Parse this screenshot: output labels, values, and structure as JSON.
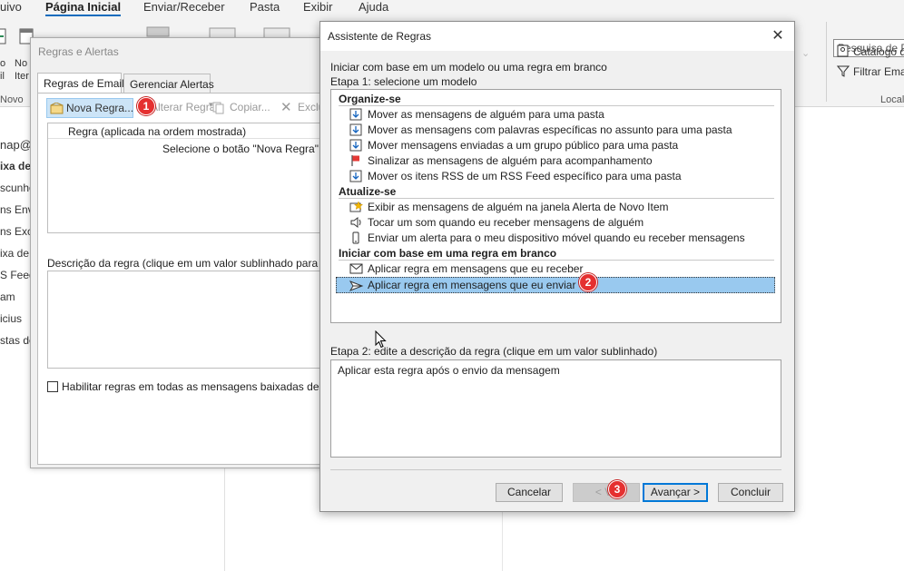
{
  "ribbon": {
    "tabs": [
      {
        "label": "uivo"
      },
      {
        "label": "Página Inicial",
        "active": true
      },
      {
        "label": "Enviar/Receber"
      },
      {
        "label": "Pasta"
      },
      {
        "label": "Exibir"
      },
      {
        "label": "Ajuda"
      }
    ],
    "new_label_1": "o",
    "new_label_2": "il",
    "new_label_3": "No",
    "new_label_4": "Iter",
    "group_novo": "Novo",
    "search_placeholder": "Pesquisa de Pe",
    "catalog": "Catálogo d",
    "filter_email": "Filtrar Ema",
    "group_local": "Local",
    "chevron": "⌄"
  },
  "folders": [
    "nap@",
    "ixa de",
    "scunho",
    "ns Envi",
    "ns Excl",
    "ixa de",
    "S Feeds",
    "am",
    "icius",
    "stas de"
  ],
  "regras_window": {
    "title": "Regras e Alertas",
    "tabs": [
      "Regras de Email",
      "Gerenciar Alertas"
    ],
    "toolbar": {
      "nova_regra": "Nova Regra...",
      "alterar_regra": "Alterar Regra",
      "copiar": "Copiar...",
      "excluir": "Exclui"
    },
    "list_header": "Regra (aplicada na ordem mostrada)",
    "list_empty": "Selecione o botão \"Nova Regra\" p",
    "description_label": "Descrição da regra (clique em um valor sublinhado para edi",
    "rss_checkbox": "Habilitar regras em todas as mensagens baixadas de RSS"
  },
  "dialog": {
    "title": "Assistente de Regras",
    "close": "✕",
    "intro": "Iniciar com base em um modelo ou uma regra em branco",
    "step1": "Etapa 1: selecione um modelo",
    "sections": [
      {
        "heading": "Organize-se",
        "items": [
          {
            "label": "Mover as mensagens de alguém para uma pasta",
            "icon": "move-folder-icon"
          },
          {
            "label": "Mover as mensagens com palavras específicas no assunto para uma pasta",
            "icon": "move-folder-icon"
          },
          {
            "label": "Mover mensagens enviadas a um grupo público para uma pasta",
            "icon": "move-folder-icon"
          },
          {
            "label": "Sinalizar as mensagens de alguém para acompanhamento",
            "icon": "flag-icon"
          },
          {
            "label": "Mover os itens RSS de um RSS Feed específico para uma pasta",
            "icon": "move-folder-icon"
          }
        ]
      },
      {
        "heading": "Atualize-se",
        "items": [
          {
            "label": "Exibir as mensagens de alguém na janela Alerta de Novo Item",
            "icon": "alert-window-icon"
          },
          {
            "label": "Tocar um som quando eu receber mensagens de alguém",
            "icon": "speaker-icon"
          },
          {
            "label": "Enviar um alerta para o meu dispositivo móvel quando eu receber mensagens",
            "icon": "mobile-icon"
          }
        ]
      },
      {
        "heading": "Iniciar com base em uma regra em branco",
        "items": [
          {
            "label": "Aplicar regra em mensagens que eu receber",
            "icon": "envelope-icon"
          },
          {
            "label": "Aplicar regra em mensagens que eu enviar",
            "icon": "send-icon",
            "selected": true
          }
        ]
      }
    ],
    "step2": "Etapa 2: edite a descrição da regra (clique em um valor sublinhado)",
    "step2_text": "Aplicar esta regra após o envio da mensagem",
    "buttons": {
      "cancelar": "Cancelar",
      "voltar": "< Vo",
      "avancar": "Avançar >",
      "concluir": "Concluir"
    }
  },
  "callouts": [
    "1",
    "2",
    "3"
  ],
  "colors": {
    "accent": "#0f6cbd",
    "selection": "#99c9ef",
    "callout": "#e53030"
  }
}
